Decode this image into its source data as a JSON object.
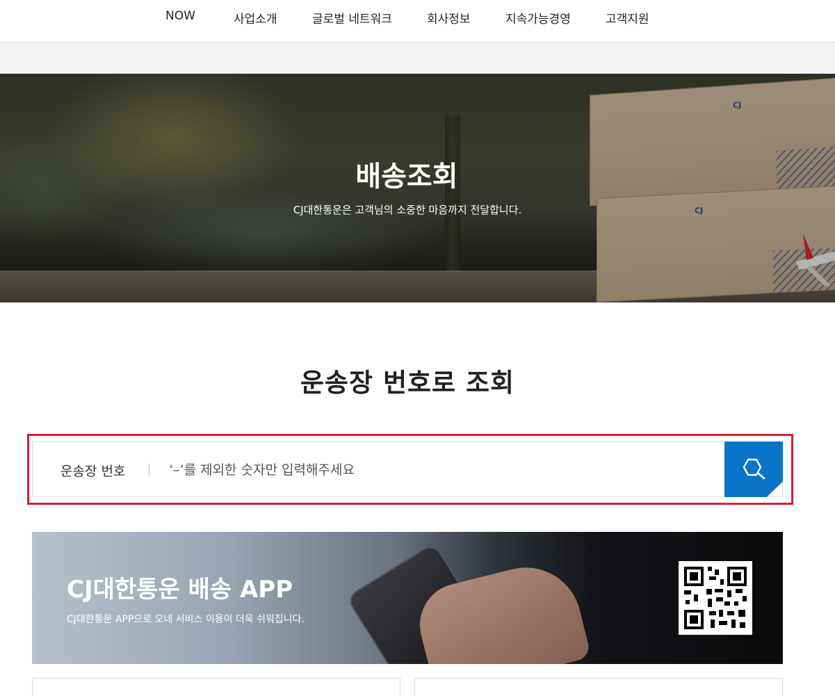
{
  "nav": {
    "items": [
      "NOW",
      "사업소개",
      "글로벌 네트워크",
      "회사정보",
      "지속가능경영",
      "고객지원"
    ]
  },
  "hero": {
    "title": "배송조회",
    "subtitle": "CJ대한통운은 고객님의 소중한 마음까지 전달합니다."
  },
  "tracking": {
    "title": "운송장 번호로 조회",
    "label": "운송장 번호",
    "placeholder": "‘–’를 제외한 숫자만 입력해주세요"
  },
  "app_banner": {
    "title": "CJ대한통운 배송 APP",
    "subtitle": "CJ대한통운 APP으로 오네 서비스 이용이 더욱 쉬워집니다."
  },
  "colors": {
    "accent_blue": "#0a74c9",
    "highlight_red": "#d8202f"
  }
}
